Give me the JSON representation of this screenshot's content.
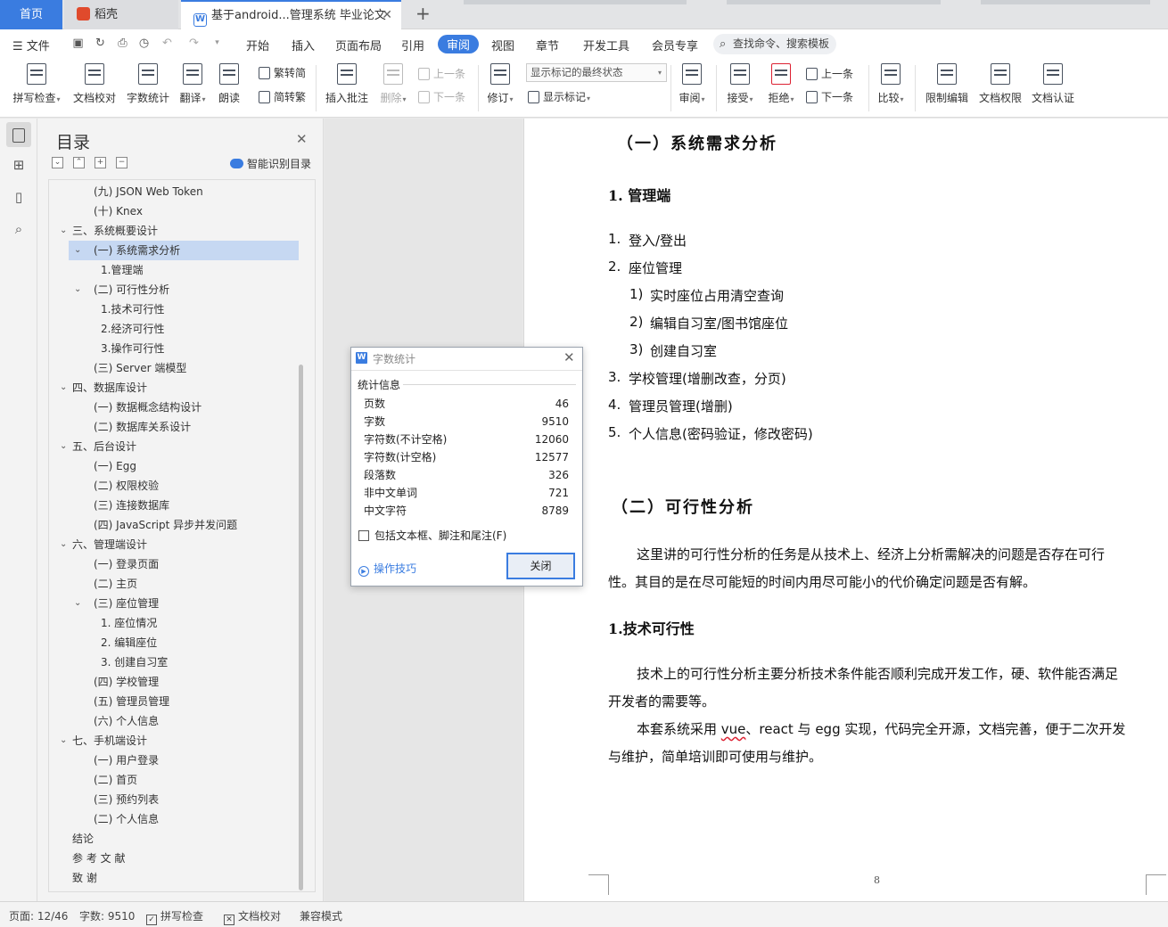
{
  "tabs": {
    "home": "首页",
    "daoke": "稻壳",
    "document": "基于android...管理系统 毕业论文"
  },
  "menu": {
    "file": "文件",
    "items": [
      "开始",
      "插入",
      "页面布局",
      "引用",
      "审阅",
      "视图",
      "章节",
      "开发工具",
      "会员专享"
    ],
    "active": "审阅",
    "search_placeholder": "查找命令、搜索模板"
  },
  "ribbon": {
    "spell_check": "拼写检查",
    "doc_proof": "文档校对",
    "word_count": "字数统计",
    "translate": "翻译",
    "read_aloud": "朗读",
    "trad_to_simp": "繁转简",
    "simp_to_trad": "简转繁",
    "insert_comment": "插入批注",
    "delete": "删除",
    "prev_comment": "上一条",
    "next_comment": "下一条",
    "revise": "修订",
    "markup_state": "显示标记的最终状态",
    "show_markup": "显示标记",
    "review": "审阅",
    "accept": "接受",
    "reject": "拒绝",
    "prev_change": "上一条",
    "next_change": "下一条",
    "compare": "比较",
    "restrict_edit": "限制编辑",
    "doc_permission": "文档权限",
    "doc_certify": "文档认证"
  },
  "toc": {
    "title": "目录",
    "ai_label": "智能识别目录",
    "items": [
      {
        "level": 2,
        "text": "(九) JSON Web Token",
        "arrow": ""
      },
      {
        "level": 2,
        "text": "(十) Knex",
        "arrow": ""
      },
      {
        "level": 1,
        "text": "三、系统概要设计",
        "arrow": "v"
      },
      {
        "level": 2,
        "text": "(一) 系统需求分析",
        "arrow": "v",
        "selected": true
      },
      {
        "level": 3,
        "text": "1.管理端",
        "arrow": ""
      },
      {
        "level": 2,
        "text": "(二) 可行性分析",
        "arrow": "v"
      },
      {
        "level": 3,
        "text": "1.技术可行性",
        "arrow": ""
      },
      {
        "level": 3,
        "text": "2.经济可行性",
        "arrow": ""
      },
      {
        "level": 3,
        "text": "3.操作可行性",
        "arrow": ""
      },
      {
        "level": 2,
        "text": "(三) Server 端模型",
        "arrow": ""
      },
      {
        "level": 1,
        "text": "四、数据库设计",
        "arrow": "v"
      },
      {
        "level": 2,
        "text": "(一) 数据概念结构设计",
        "arrow": ""
      },
      {
        "level": 2,
        "text": "(二) 数据库关系设计",
        "arrow": ""
      },
      {
        "level": 1,
        "text": "五、后台设计",
        "arrow": "v"
      },
      {
        "level": 2,
        "text": "(一)  Egg",
        "arrow": ""
      },
      {
        "level": 2,
        "text": "(二)  权限校验",
        "arrow": ""
      },
      {
        "level": 2,
        "text": "(三) 连接数据库",
        "arrow": ""
      },
      {
        "level": 2,
        "text": "(四) JavaScript 异步并发问题",
        "arrow": ""
      },
      {
        "level": 1,
        "text": "六、管理端设计",
        "arrow": "v"
      },
      {
        "level": 2,
        "text": "(一) 登录页面",
        "arrow": ""
      },
      {
        "level": 2,
        "text": "(二) 主页",
        "arrow": ""
      },
      {
        "level": 2,
        "text": "(三) 座位管理",
        "arrow": "v"
      },
      {
        "level": 3,
        "text": "1. 座位情况",
        "arrow": ""
      },
      {
        "level": 3,
        "text": "2. 编辑座位",
        "arrow": ""
      },
      {
        "level": 3,
        "text": "3. 创建自习室",
        "arrow": ""
      },
      {
        "level": 2,
        "text": "(四) 学校管理",
        "arrow": ""
      },
      {
        "level": 2,
        "text": "(五) 管理员管理",
        "arrow": ""
      },
      {
        "level": 2,
        "text": "(六) 个人信息",
        "arrow": ""
      },
      {
        "level": 1,
        "text": "七、手机端设计",
        "arrow": "v"
      },
      {
        "level": 2,
        "text": "(一) 用户登录",
        "arrow": ""
      },
      {
        "level": 2,
        "text": "(二) 首页",
        "arrow": ""
      },
      {
        "level": 2,
        "text": "(三) 预约列表",
        "arrow": ""
      },
      {
        "level": 2,
        "text": "(二) 个人信息",
        "arrow": ""
      },
      {
        "level": 1,
        "text": "结论",
        "arrow": ""
      },
      {
        "level": 1,
        "text": "参 考 文 献",
        "arrow": ""
      },
      {
        "level": 1,
        "text": "致   谢",
        "arrow": ""
      }
    ]
  },
  "document": {
    "heading1": "（一）系统需求分析",
    "heading_admin": "1.  管理端",
    "list": [
      {
        "num": "1.",
        "text": "登入/登出",
        "indent": 0
      },
      {
        "num": "2.",
        "text": "座位管理",
        "indent": 0
      },
      {
        "num": "1)",
        "text": "实时座位占用清空查询",
        "indent": 1
      },
      {
        "num": "2)",
        "text": "编辑自习室/图书馆座位",
        "indent": 1
      },
      {
        "num": "3)",
        "text": "创建自习室",
        "indent": 1
      },
      {
        "num": "3.",
        "text": "学校管理(增删改查，分页)",
        "indent": 0
      },
      {
        "num": "4.",
        "text": "管理员管理(增删)",
        "indent": 0
      },
      {
        "num": "5.",
        "text": "个人信息(密码验证，修改密码)",
        "indent": 0
      }
    ],
    "heading2": "（二）可行性分析",
    "para1_line1": "这里讲的可行性分析的任务是从技术上、经济上分析需解决的问题是否存在可行",
    "para1_line2": "性。其目的是在尽可能短的时间内用尽可能小的代价确定问题是否有解。",
    "heading_tech": "1.技术可行性",
    "para2_line1": "技术上的可行性分析主要分析技术条件能否顺利完成开发工作，硬、软件能否满足",
    "para2_line2": "开发者的需要等。",
    "para3_pre": "本套系统采用 ",
    "para3_vue": "vue",
    "para3_mid": "、react 与 egg 实现，代码完全开源，文档完善，便于二次开发",
    "para3_line2": "与维护，简单培训即可使用与维护。",
    "page_number": "8"
  },
  "dialog": {
    "title": "字数统计",
    "group": "统计信息",
    "stats": [
      {
        "label": "页数",
        "value": "46"
      },
      {
        "label": "字数",
        "value": "9510"
      },
      {
        "label": "字符数(不计空格)",
        "value": "12060"
      },
      {
        "label": "字符数(计空格)",
        "value": "12577"
      },
      {
        "label": "段落数",
        "value": "326"
      },
      {
        "label": "非中文单词",
        "value": "721"
      },
      {
        "label": "中文字符",
        "value": "8789"
      }
    ],
    "include_label": "包括文本框、脚注和尾注(F)",
    "include_checked": false,
    "tips": "操作技巧",
    "close": "关闭"
  },
  "status": {
    "page": "页面: 12/46",
    "words": "字数: 9510",
    "spell": "拼写检查",
    "proof": "文档校对",
    "compat": "兼容模式"
  },
  "colors": {
    "accent": "#3a7ce0",
    "toc_selected": "#c6d8f2",
    "spell_underline": "#dd2233"
  }
}
